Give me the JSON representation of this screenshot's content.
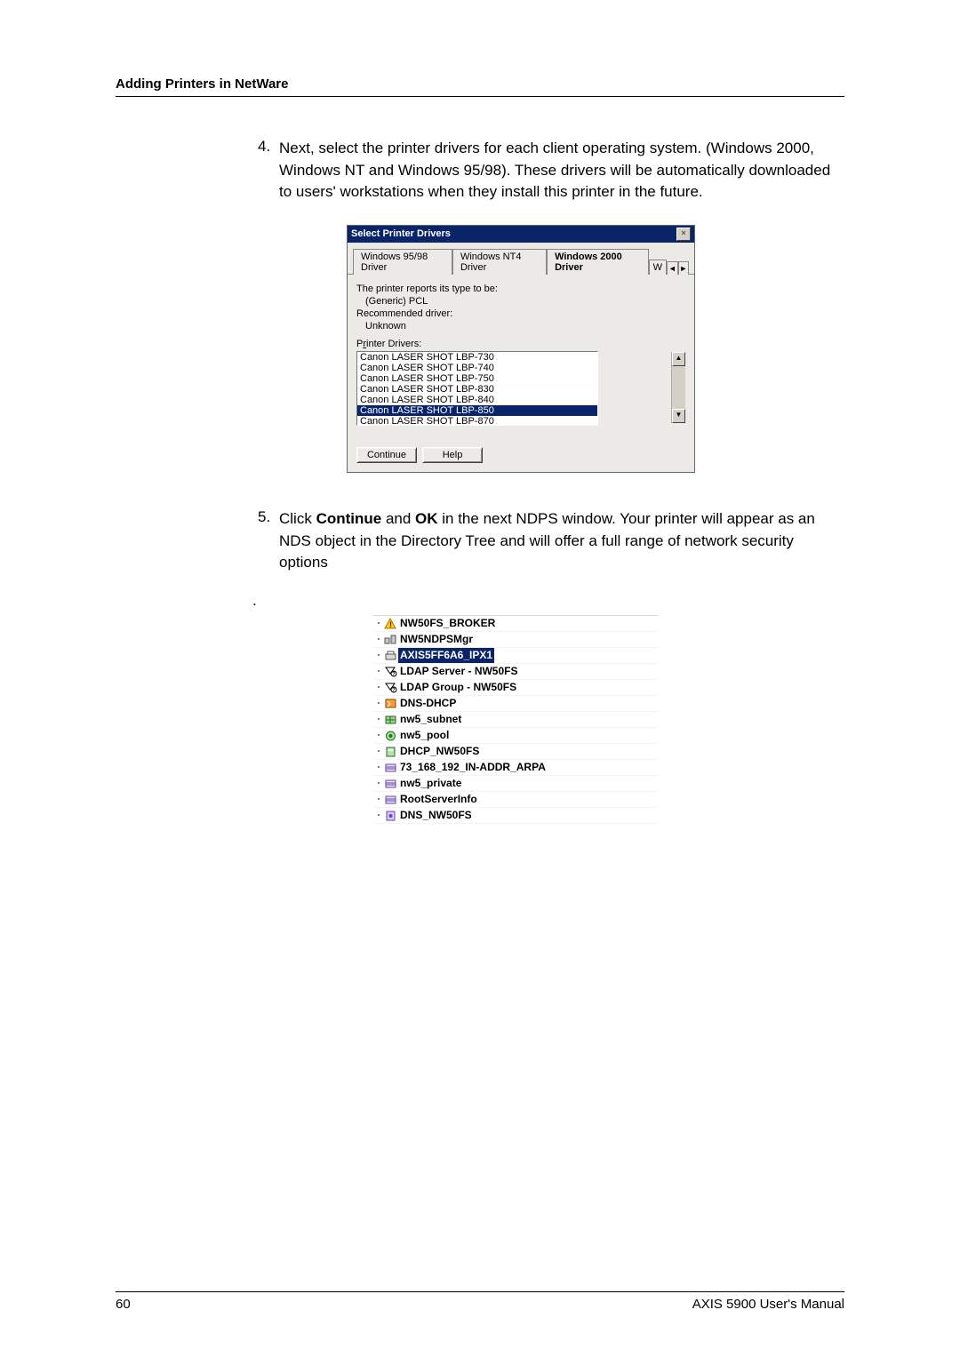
{
  "header": "Adding Printers in NetWare",
  "step4": {
    "num": "4.",
    "text": "Next, select the printer drivers for each client operating system. (Windows 2000, Windows NT and Windows 95/98). These drivers will be automatically downloaded to users' workstations when they install this printer in the future."
  },
  "dialog": {
    "title": "Select Printer Drivers",
    "close_glyph": "×",
    "tabs": {
      "win9598": "Windows 95/98 Driver",
      "winnt4": "Windows NT4 Driver",
      "win2000": "Windows 2000 Driver",
      "w": "W",
      "left": "◄",
      "right": "►"
    },
    "type_label": "The printer reports its type to be:",
    "type_value": "(Generic) PCL",
    "rec_label": "Recommended driver:",
    "rec_value": "Unknown",
    "list_label_pre": "P",
    "list_label_u": "r",
    "list_label_post": "inter Drivers:",
    "drivers": [
      "Canon LASER SHOT LBP-730",
      "Canon LASER SHOT LBP-740",
      "Canon LASER SHOT LBP-750",
      "Canon LASER SHOT LBP-830",
      "Canon LASER SHOT LBP-840",
      "Canon LASER SHOT LBP-850",
      "Canon LASER SHOT LBP-870"
    ],
    "selected_driver_index": 5,
    "scroll_up": "▲",
    "scroll_down": "▼",
    "btn_continue": "Continue",
    "btn_help": "Help"
  },
  "step5": {
    "num": "5.",
    "pre": "Click ",
    "b1": "Continue",
    "mid1": " and ",
    "b2": "OK",
    "mid2": " in the next NDPS window. Your printer will appear as an NDS object in the Directory Tree and will offer a full range of network security options",
    "dot": "."
  },
  "tree": {
    "items": [
      {
        "label": "NW50FS_BROKER",
        "selected": false,
        "icon": "broker"
      },
      {
        "label": "NW5NDPSMgr",
        "selected": false,
        "icon": "mgr"
      },
      {
        "label": "AXIS5FF6A6_IPX1",
        "selected": true,
        "icon": "printer"
      },
      {
        "label": "LDAP Server - NW50FS",
        "selected": false,
        "icon": "ldap"
      },
      {
        "label": "LDAP Group - NW50FS",
        "selected": false,
        "icon": "ldap"
      },
      {
        "label": "DNS-DHCP",
        "selected": false,
        "icon": "dnsdhcp"
      },
      {
        "label": "nw5_subnet",
        "selected": false,
        "icon": "subnet"
      },
      {
        "label": "nw5_pool",
        "selected": false,
        "icon": "pool"
      },
      {
        "label": "DHCP_NW50FS",
        "selected": false,
        "icon": "dhcp"
      },
      {
        "label": "73_168_192_IN-ADDR_ARPA",
        "selected": false,
        "icon": "zone"
      },
      {
        "label": "nw5_private",
        "selected": false,
        "icon": "zone"
      },
      {
        "label": "RootServerInfo",
        "selected": false,
        "icon": "zone"
      },
      {
        "label": "DNS_NW50FS",
        "selected": false,
        "icon": "dns"
      }
    ]
  },
  "footer": {
    "page": "60",
    "right": "AXIS 5900 User's Manual"
  }
}
